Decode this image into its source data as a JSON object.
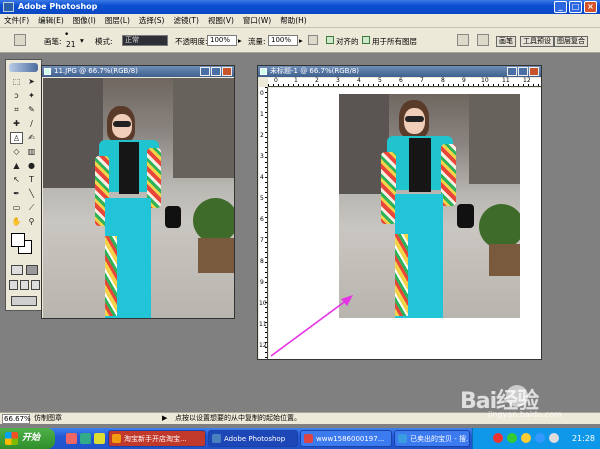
{
  "app": {
    "title": "Adobe Photoshop"
  },
  "window_controls": {
    "minimize": "_",
    "maximize": "□",
    "close": "×"
  },
  "menubar": [
    "文件(F)",
    "编辑(E)",
    "图像(I)",
    "图层(L)",
    "选择(S)",
    "滤镜(T)",
    "视图(V)",
    "窗口(W)",
    "帮助(H)"
  ],
  "options": {
    "brush_label": "画笔:",
    "brush_size": "21",
    "mode_label": "模式:",
    "mode_value": "正常",
    "opacity_label": "不透明度:",
    "opacity_value": "100%",
    "flow_label": "流量:",
    "flow_value": "100%",
    "aligned_label": "对齐的",
    "all_layers_label": "用于所有图层",
    "palette_tabs": [
      "画笔",
      "工具预设",
      "图层复合"
    ]
  },
  "documents": {
    "source": {
      "title": "11.JPG @ 66.7%(RGB/8)"
    },
    "target": {
      "title": "未标题-1 @ 66.7%(RGB/8)"
    }
  },
  "rulers": {
    "horizontal": [
      "0",
      "1",
      "2",
      "3",
      "4",
      "5",
      "6",
      "7",
      "8",
      "9",
      "10",
      "11",
      "12"
    ],
    "vertical": [
      "0",
      "1",
      "2",
      "3",
      "4",
      "5",
      "6",
      "7",
      "8",
      "9",
      "10",
      "11",
      "12"
    ]
  },
  "statusbar": {
    "zoom": "66.67%",
    "tool": "仿制图章",
    "hint": "点按以设置想要的从中复制的起始位置。"
  },
  "taskbar": {
    "start": "开始",
    "tasks": [
      "淘宝新手开店淘宝...",
      "Adobe Photoshop",
      "www1586000197...",
      "已卖出的宝贝 - 搜..."
    ],
    "clock": "21:28"
  },
  "watermark": {
    "text": "Bai经验",
    "sub": "jingyan.baidu.com"
  },
  "colors": {
    "arrow": "#e432e4",
    "title_blue": "#0b4fd0",
    "jacket": "#1fc4cf"
  }
}
